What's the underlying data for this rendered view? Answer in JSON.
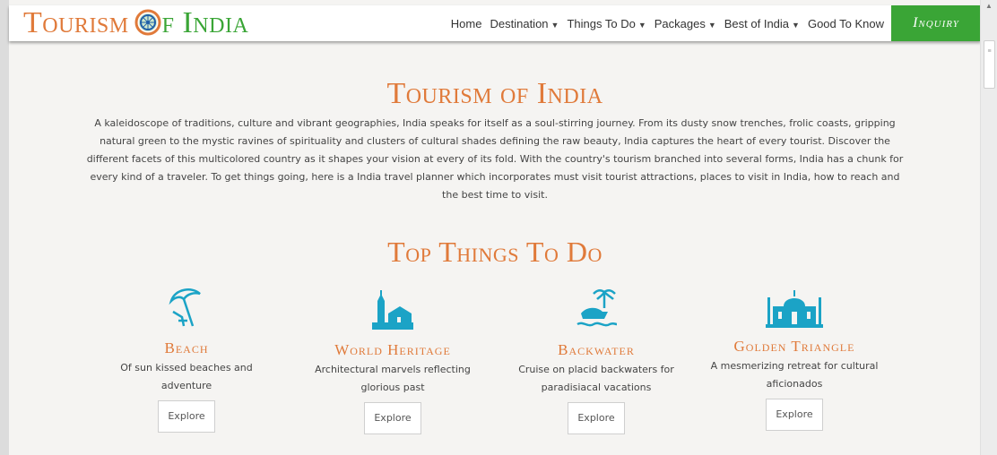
{
  "header": {
    "logo": {
      "word1": "Tourism",
      "word2": "f India"
    },
    "nav": [
      {
        "label": "Home",
        "dropdown": false
      },
      {
        "label": "Destination",
        "dropdown": true
      },
      {
        "label": "Things To Do",
        "dropdown": true
      },
      {
        "label": "Packages",
        "dropdown": true
      },
      {
        "label": "Best of India",
        "dropdown": true
      },
      {
        "label": "Good To Know",
        "dropdown": false
      }
    ],
    "inquiry_label": "Inquiry"
  },
  "main": {
    "title": "Tourism of India",
    "intro": "A kaleidoscope of traditions, culture and vibrant geographies, India speaks for itself as a soul-stirring journey. From its dusty snow trenches, frolic coasts, gripping natural green to the mystic ravines of spirituality and clusters of cultural shades defining the raw beauty, India captures the heart of every tourist. Discover the different facets of this multicolored country as it shapes your vision at every of its fold. With the country's tourism branched into several forms, India has a chunk for every kind of a traveler. To get things going, here is a India travel planner which incorporates must visit tourist attractions, places to visit in India, how to reach and the best time to visit.",
    "things_title": "Top Things To Do",
    "cards": [
      {
        "title": "Beach",
        "desc": "Of sun kissed beaches and adventure",
        "button": "Explore",
        "icon": "beach-umbrella-icon"
      },
      {
        "title": "World Heritage",
        "desc": "Architectural marvels reflecting glorious past",
        "button": "Explore",
        "icon": "heritage-temple-icon"
      },
      {
        "title": "Backwater",
        "desc": "Cruise on placid backwaters for paradisiacal vacations",
        "button": "Explore",
        "icon": "houseboat-icon"
      },
      {
        "title": "Golden Triangle",
        "desc": "A mesmerizing retreat for cultural aficionados",
        "button": "Explore",
        "icon": "taj-mahal-icon"
      }
    ]
  },
  "colors": {
    "accent": "#e07a3a",
    "green": "#3aa536",
    "icon_teal": "#1ba3c6"
  }
}
